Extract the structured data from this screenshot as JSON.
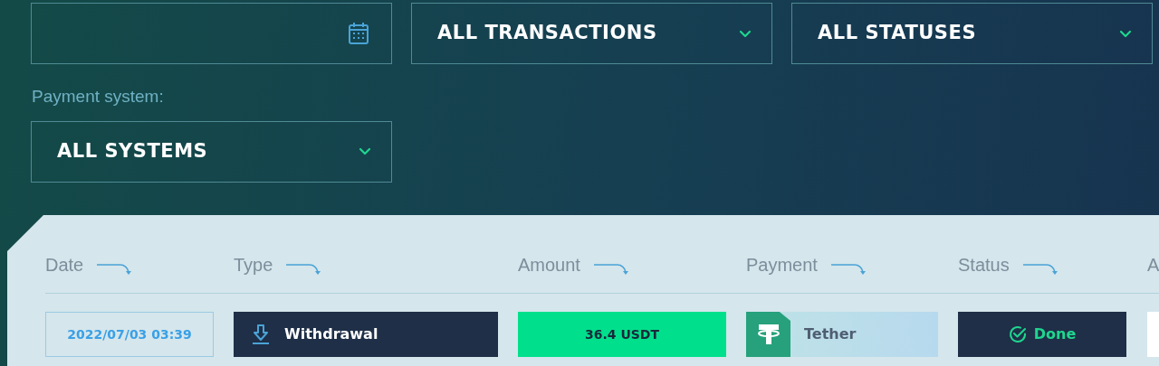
{
  "filters": [
    {
      "kind": "date"
    },
    {
      "kind": "dropdown",
      "value": "ALL TRANSACTIONS"
    },
    {
      "kind": "dropdown",
      "value": "ALL STATUSES"
    }
  ],
  "payment_filter": {
    "label": "Payment system:",
    "value": "ALL SYSTEMS"
  },
  "table": {
    "columns": [
      "Date",
      "Type",
      "Amount",
      "Payment",
      "Status",
      "A"
    ],
    "rows": [
      {
        "date": "2022/07/03 03:39",
        "type": "Withdrawal",
        "amount": "36.4 USDT",
        "payment": "Tether",
        "status": "Done"
      }
    ]
  }
}
